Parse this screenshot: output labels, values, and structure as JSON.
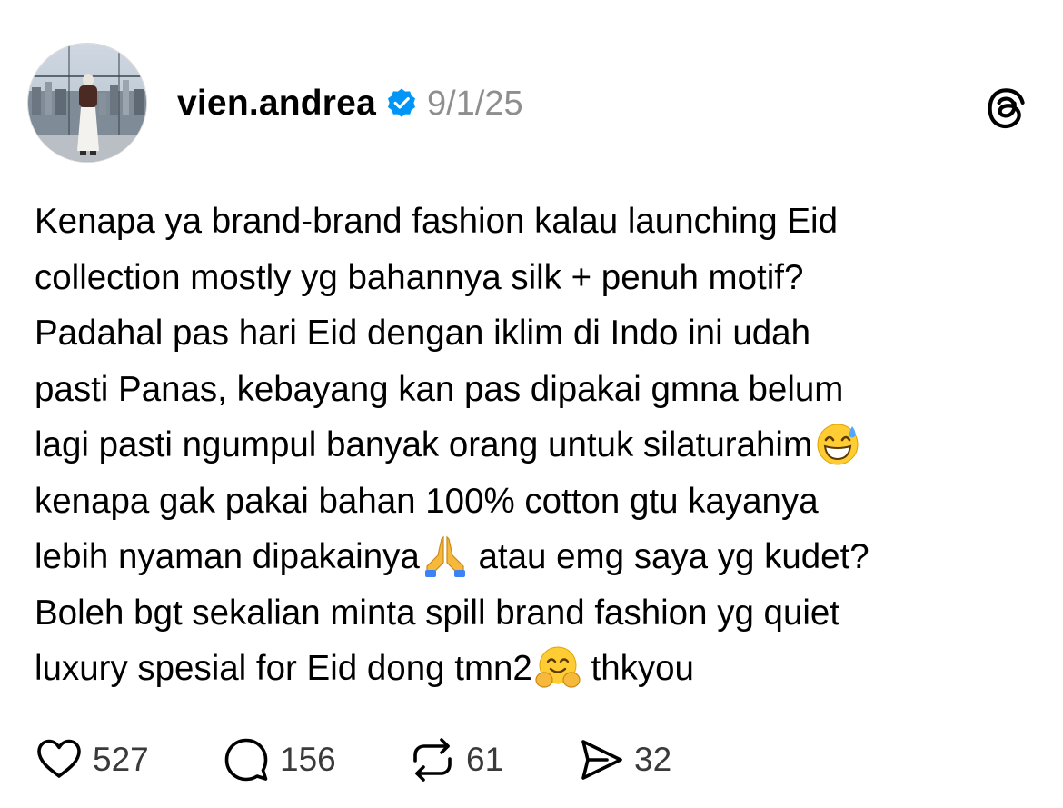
{
  "post": {
    "username": "vien.andrea",
    "verified": true,
    "timestamp": "9/1/25",
    "text_lines": [
      "Kenapa ya brand-brand fashion kalau launching Eid",
      "collection mostly yg bahannya silk + penuh motif?",
      "Padahal pas hari Eid dengan iklim di Indo ini udah",
      "pasti Panas, kebayang kan pas dipakai gmna belum",
      "lagi pasti ngumpul banyak orang untuk silaturahim",
      "kenapa gak pakai bahan 100% cotton gtu kayanya",
      "lebih nyaman dipakainya",
      " atau emg saya yg kudet?",
      "Boleh bgt sekalian minta spill brand fashion yg quiet",
      "luxury spesial for Eid dong tmn2",
      " thkyou"
    ],
    "emojis": [
      "grinning-sweat-emoji",
      "folded-hands-emoji",
      "hugging-face-emoji"
    ]
  },
  "actions": {
    "likes": "527",
    "replies": "156",
    "reposts": "61",
    "shares": "32"
  },
  "icons": {
    "like": "heart-icon",
    "reply": "comment-bubble-icon",
    "repost": "repost-icon",
    "share": "send-icon",
    "brand": "threads-logo-icon",
    "verified": "verified-badge-icon"
  },
  "colors": {
    "verified": "#0095f6",
    "text": "#000000",
    "muted": "#8e8e8e",
    "icon": "#000000"
  }
}
